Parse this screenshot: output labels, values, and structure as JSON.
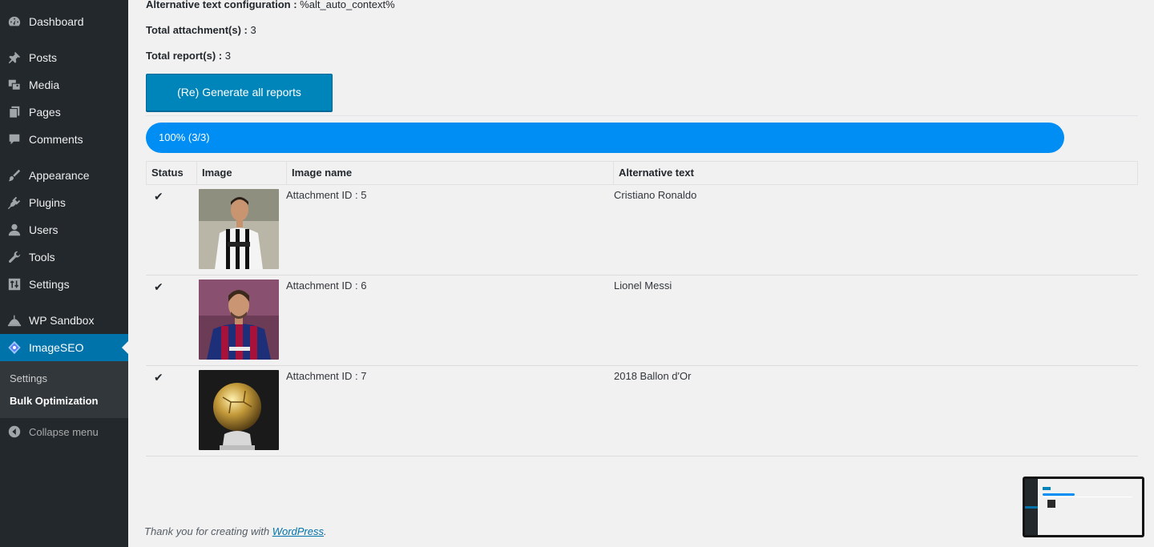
{
  "sidebar": {
    "items": [
      {
        "label": "Dashboard",
        "icon": "dashboard-icon"
      },
      {
        "label": "Posts",
        "icon": "pin-icon"
      },
      {
        "label": "Media",
        "icon": "media-icon"
      },
      {
        "label": "Pages",
        "icon": "pages-icon"
      },
      {
        "label": "Comments",
        "icon": "comments-icon"
      },
      {
        "label": "Appearance",
        "icon": "brush-icon"
      },
      {
        "label": "Plugins",
        "icon": "plugin-icon"
      },
      {
        "label": "Users",
        "icon": "users-icon"
      },
      {
        "label": "Tools",
        "icon": "wrench-icon"
      },
      {
        "label": "Settings",
        "icon": "settings-sliders-icon"
      },
      {
        "label": "WP Sandbox",
        "icon": "sandbox-icon"
      },
      {
        "label": "ImageSEO",
        "icon": "imageseo-logo-icon"
      }
    ],
    "submenu": [
      {
        "label": "Settings"
      },
      {
        "label": "Bulk Optimization"
      }
    ],
    "collapse_label": "Collapse menu"
  },
  "main": {
    "alt_config_label": "Alternative text configuration :",
    "alt_config_value": "%alt_auto_context%",
    "attachments_label": "Total attachment(s) :",
    "attachments_value": "3",
    "reports_label": "Total report(s) :",
    "reports_value": "3",
    "generate_button": "(Re) Generate all reports",
    "progress": {
      "text": "100% (3/3)",
      "fraction": 1.0
    }
  },
  "table": {
    "headers": [
      "Status",
      "Image",
      "Image name",
      "Alternative text"
    ],
    "rows": [
      {
        "status": "✔",
        "name": "Attachment ID : 5",
        "alt": "Cristiano Ronaldo"
      },
      {
        "status": "✔",
        "name": "Attachment ID : 6",
        "alt": "Lionel Messi"
      },
      {
        "status": "✔",
        "name": "Attachment ID : 7",
        "alt": "2018 Ballon d'Or"
      }
    ]
  },
  "footer": {
    "text": "Thank you for creating with",
    "link": "WordPress",
    "suffix": "."
  },
  "colors": {
    "sidebar_bg": "#23282d",
    "accent": "#0073aa",
    "button": "#0085ba",
    "progress": "#008ef5"
  }
}
